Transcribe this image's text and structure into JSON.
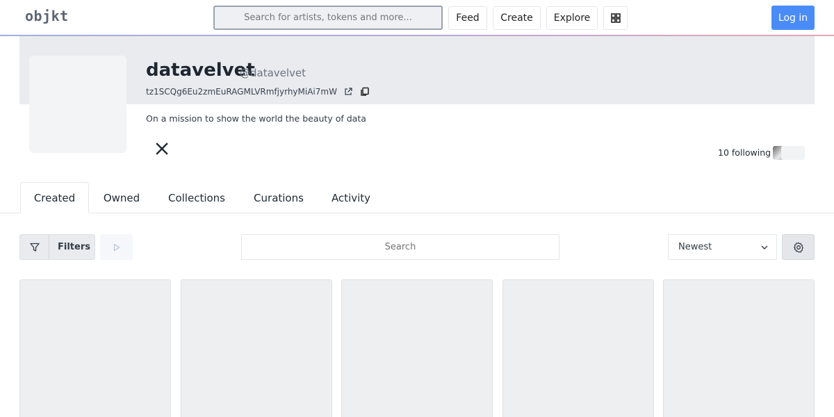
{
  "header": {
    "logo": "objkt",
    "search_placeholder": "Search for artists, tokens and more...",
    "nav": {
      "feed": "Feed",
      "create": "Create",
      "explore": "Explore"
    },
    "login": "Log in"
  },
  "profile": {
    "username": "datavelvet",
    "handle": "@datavelvet",
    "address": "tz1SCQg6Eu2zmEuRAGMLVRmfjyrhyMiAi7mW",
    "bio": "On a mission to show the world the beauty of data",
    "following": "10 following"
  },
  "tabs": [
    "Created",
    "Owned",
    "Collections",
    "Curations",
    "Activity"
  ],
  "active_tab": "Created",
  "toolbar": {
    "filters_label": "Filters",
    "search_placeholder": "Search",
    "sort_value": "Newest"
  },
  "colors": {
    "accent": "#4a8cf7",
    "banner": "#e9ebee",
    "card": "#eeeff1"
  },
  "icons": {
    "external": "external-link-icon",
    "copy": "copy-icon",
    "social": "x-logo-icon",
    "filter": "filter-icon",
    "play": "play-icon",
    "sort": "chevron-down-icon",
    "settings": "gear-icon",
    "grid": "grid-icon"
  }
}
